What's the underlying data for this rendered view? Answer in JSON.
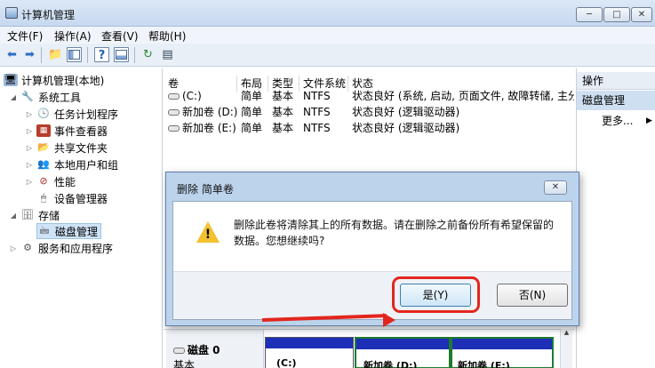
{
  "window": {
    "title": "计算机管理",
    "buttons": [
      "─",
      "□",
      "✕"
    ]
  },
  "menu": [
    "文件(F)",
    "操作(A)",
    "查看(V)",
    "帮助(H)"
  ],
  "tree": {
    "root": "计算机管理(本地)",
    "system_tools": "系统工具",
    "task_scheduler": "任务计划程序",
    "event_viewer": "事件查看器",
    "shared_folders": "共享文件夹",
    "local_users": "本地用户和组",
    "performance": "性能",
    "device_manager": "设备管理器",
    "storage": "存储",
    "disk_management": "磁盘管理",
    "services": "服务和应用程序"
  },
  "list": {
    "headers": [
      "卷",
      "布局",
      "类型",
      "文件系统",
      "状态"
    ],
    "rows": [
      [
        "(C:)",
        "简单",
        "基本",
        "NTFS",
        "状态良好 (系统, 启动, 页面文件, 故障转储, 主分区)"
      ],
      [
        "新加卷 (D:)",
        "简单",
        "基本",
        "NTFS",
        "状态良好 (逻辑驱动器)"
      ],
      [
        "新加卷 (E:)",
        "简单",
        "基本",
        "NTFS",
        "状态良好 (逻辑驱动器)"
      ]
    ]
  },
  "actions": {
    "header": "操作",
    "selected": "磁盘管理",
    "more": "更多..."
  },
  "diskmap": {
    "disk_name": "磁盘 0",
    "disk_type": "基本",
    "partitions": [
      "(C:)",
      "新加卷 (D:)",
      "新加卷 (E:)"
    ]
  },
  "dialog": {
    "title": "删除 简单卷",
    "message": "删除此卷将清除其上的所有数据。请在删除之前备份所有希望保留的数据。您想继续吗?",
    "yes_label": "是(Y)",
    "no_label": "否(N)",
    "close_glyph": "✕"
  },
  "colors": {
    "accent_red": "#e3261d",
    "partition_blue": "#1c2fb6",
    "warning_yellow": "#f2c230"
  }
}
